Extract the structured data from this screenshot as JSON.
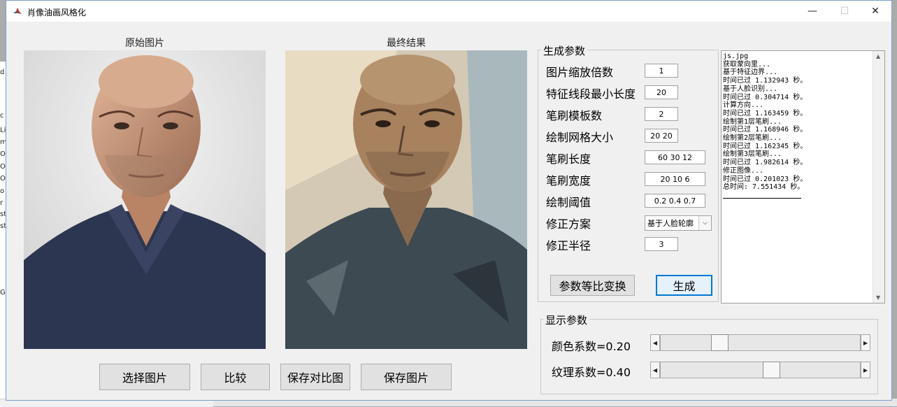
{
  "window": {
    "title": "肖像油画风格化",
    "minimize": "—",
    "maximize": "☐",
    "close": "✕"
  },
  "background_window": {
    "rows": [
      "d",
      "c",
      "Li",
      "m",
      "O",
      "O",
      "O",
      "o",
      "r",
      "st",
      "st",
      "G"
    ]
  },
  "original_image": {
    "label": "原始图片"
  },
  "result_image": {
    "label": "最终结果"
  },
  "buttons": {
    "select": "选择图片",
    "compare": "比较",
    "save_compare": "保存对比图",
    "save_image": "保存图片",
    "scale_params": "参数等比变换",
    "generate": "生成"
  },
  "gen_params": {
    "title": "生成参数",
    "items": [
      {
        "label": "图片缩放倍数",
        "value": "1"
      },
      {
        "label": "特征线段最小长度",
        "value": "20"
      },
      {
        "label": "笔刷模板数",
        "value": "2"
      },
      {
        "label": "绘制网格大小",
        "value": "20 20"
      },
      {
        "label": "笔刷长度",
        "value": "60 30 12"
      },
      {
        "label": "笔刷宽度",
        "value": "20 10 6"
      },
      {
        "label": "绘制阈值",
        "value": "0.2 0.4 0.7"
      },
      {
        "label": "修正方案",
        "value": "基于人脸轮廓"
      },
      {
        "label": "修正半径",
        "value": "3"
      }
    ]
  },
  "log": {
    "lines": [
      "js.jpg",
      "获取蒙向里...",
      "基于特征边界...",
      "时间已过 1.132943 秒。",
      "基于人脸识别...",
      "时间已过 0.304714 秒。",
      "计算方向...",
      "时间已过 1.163459 秒。",
      "绘制第1层笔刷...",
      "时间已过 1.168946 秒。",
      "绘制第2层笔刷...",
      "时间已过 1.162345 秒。",
      "绘制第3层笔刷...",
      "时间已过 1.982614 秒。",
      "修正图像...",
      "时间已过 0.201023 秒。",
      "总时间: 7.551434 秒。"
    ]
  },
  "display_params": {
    "title": "显示参数",
    "color": {
      "label": "颜色系数=0.20",
      "value": 0.2
    },
    "texture": {
      "label": "纹理系数=0.40",
      "value": 0.4
    }
  },
  "colors": {
    "accent": "#0078d7",
    "window_bg": "#f0f0f0"
  }
}
